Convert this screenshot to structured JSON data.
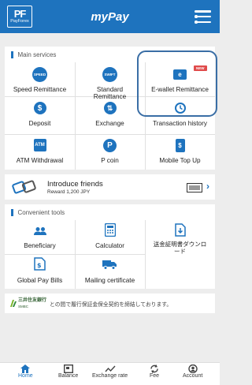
{
  "header": {
    "logo_mark": "PF",
    "logo_text": "PayForex",
    "title": "myPay"
  },
  "main_services": {
    "title": "Main services",
    "items": [
      {
        "label": "Speed Remittance",
        "icon": "speed-badge-icon",
        "icon_text": "SPEED"
      },
      {
        "label": "Standard Remittance",
        "icon": "swift-badge-icon",
        "icon_text": "SWIFT"
      },
      {
        "label": "E-wallet Remittance",
        "icon": "ewallet-icon",
        "badge": "NEW"
      },
      {
        "label": "Deposit",
        "icon": "dollar-icon"
      },
      {
        "label": "Exchange",
        "icon": "exchange-icon"
      },
      {
        "label": "Transaction history",
        "icon": "history-icon"
      },
      {
        "label": "ATM Withdrawal",
        "icon": "atm-icon"
      },
      {
        "label": "P coin",
        "icon": "p-coin-icon"
      },
      {
        "label": "Mobile Top Up",
        "icon": "mobile-icon"
      }
    ]
  },
  "invite": {
    "title": "Introduce friends",
    "subtitle": "Reward 1,200 JPY"
  },
  "convenient_tools": {
    "title": "Convenient tools",
    "items": [
      {
        "label": "Beneficiary",
        "icon": "people-icon"
      },
      {
        "label": "Calculator",
        "icon": "calculator-icon"
      },
      {
        "label": "送金証明書ダウンロード",
        "icon": "download-certificate-icon"
      },
      {
        "label": "Global Pay Bills",
        "icon": "pay-bills-icon"
      },
      {
        "label": "Mailing certificate",
        "icon": "truck-icon"
      }
    ]
  },
  "bank_notice": {
    "bank_name": "三井住友銀行",
    "bank_sub": "SMBC",
    "text": "との間で履行保証金保全契約を締結しております。"
  },
  "tabbar": {
    "items": [
      {
        "label": "Home",
        "icon": "home-icon",
        "active": true
      },
      {
        "label": "Balance",
        "icon": "balance-icon"
      },
      {
        "label": "Exchange rate",
        "icon": "chart-icon"
      },
      {
        "label": "Fee",
        "icon": "fee-icon"
      },
      {
        "label": "Account",
        "icon": "account-icon"
      }
    ]
  },
  "colors": {
    "brand": "#1e73be",
    "background": "#ededed",
    "badge": "#e04b4b",
    "highlight": "#3a6ea5"
  }
}
